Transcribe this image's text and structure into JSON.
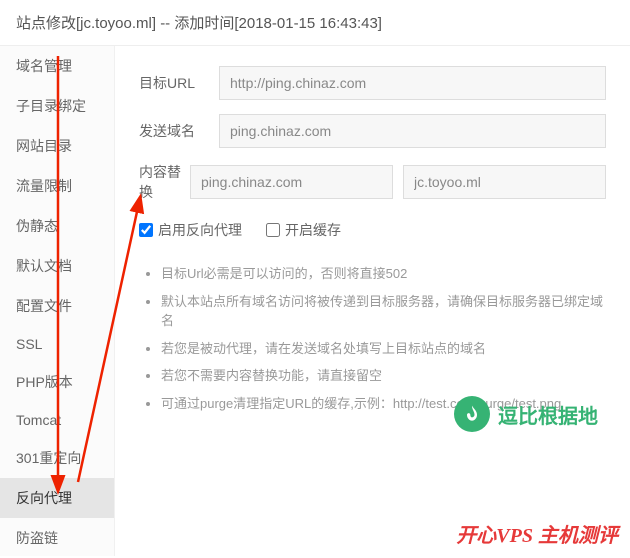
{
  "header": {
    "title": "站点修改[jc.toyoo.ml] -- 添加时间[2018-01-15 16:43:43]"
  },
  "sidebar": {
    "items": [
      "域名管理",
      "子目录绑定",
      "网站目录",
      "流量限制",
      "伪静态",
      "默认文档",
      "配置文件",
      "SSL",
      "PHP版本",
      "Tomcat",
      "301重定向",
      "反向代理",
      "防盗链"
    ],
    "active_index": 11
  },
  "form": {
    "target_url_label": "目标URL",
    "target_url_value": "http://ping.chinaz.com",
    "send_domain_label": "发送域名",
    "send_domain_value": "ping.chinaz.com",
    "content_replace_label": "内容替换",
    "content_replace_from": "ping.chinaz.com",
    "content_replace_to": "jc.toyoo.ml",
    "enable_proxy_label": "启用反向代理",
    "enable_proxy_checked": true,
    "enable_cache_label": "开启缓存",
    "enable_cache_checked": false
  },
  "notes": [
    "目标Url必需是可以访问的，否则将直接502",
    "默认本站点所有域名访问将被传递到目标服务器，请确保目标服务器已绑定域名",
    "若您是被动代理，请在发送域名处填写上目标站点的域名",
    "若您不需要内容替换功能，请直接留空",
    "可通过purge清理指定URL的缓存,示例：http://test.com/purge/test.png"
  ],
  "watermark1_text": "逗比根据地",
  "watermark2_text": "开心VPS 主机测评"
}
